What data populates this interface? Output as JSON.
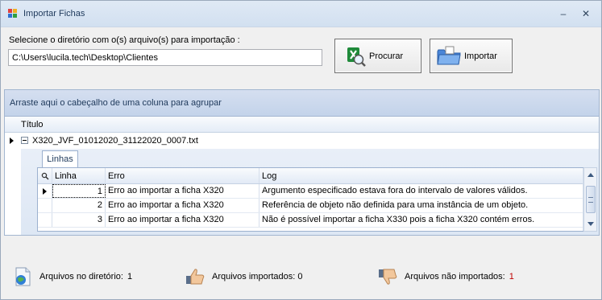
{
  "window": {
    "title": "Importar Fichas",
    "minimize_glyph": "–",
    "close_glyph": "✕"
  },
  "top_panel": {
    "prompt_label": "Selecione o diretório com o(s) arquivo(s) para importação :",
    "path_value": "C:\\Users\\lucila.tech\\Desktop\\Clientes",
    "search_button_label": "Procurar",
    "search_button_icon": "excel-search-icon",
    "import_button_label": "Importar",
    "import_button_icon": "folder-import-icon"
  },
  "grid": {
    "group_panel_text": "Arraste aqui o cabeçalho de uma coluna para agrupar",
    "column_title": "Título",
    "master_row_text": "X320_JVF_01012020_31122020_0007.txt",
    "detail_tab_label": "Linhas",
    "detail_columns": {
      "linha": "Linha",
      "erro": "Erro",
      "log": "Log"
    },
    "detail_rows": [
      {
        "linha": "1",
        "erro": "Erro ao importar a ficha X320",
        "log": "Argumento especificado estava fora do intervalo de valores válidos."
      },
      {
        "linha": "2",
        "erro": "Erro ao importar a ficha X320",
        "log": "Referência de objeto não definida para uma instância de um objeto."
      },
      {
        "linha": "3",
        "erro": "Erro ao importar a ficha X320",
        "log": "Não é possível importar a ficha X330 pois a ficha X320 contém erros."
      }
    ]
  },
  "status": {
    "files_in_dir_label": "Arquivos no diretório:",
    "files_in_dir_value": "1",
    "imported_label": "Arquivos importados: 0",
    "not_imported_label": "Arquivos não importados:",
    "not_imported_value": "1",
    "files_icon": "document-globe-icon",
    "imported_icon": "thumbs-up-icon",
    "not_imported_icon": "thumbs-down-icon",
    "not_imported_color": "#c00000"
  }
}
